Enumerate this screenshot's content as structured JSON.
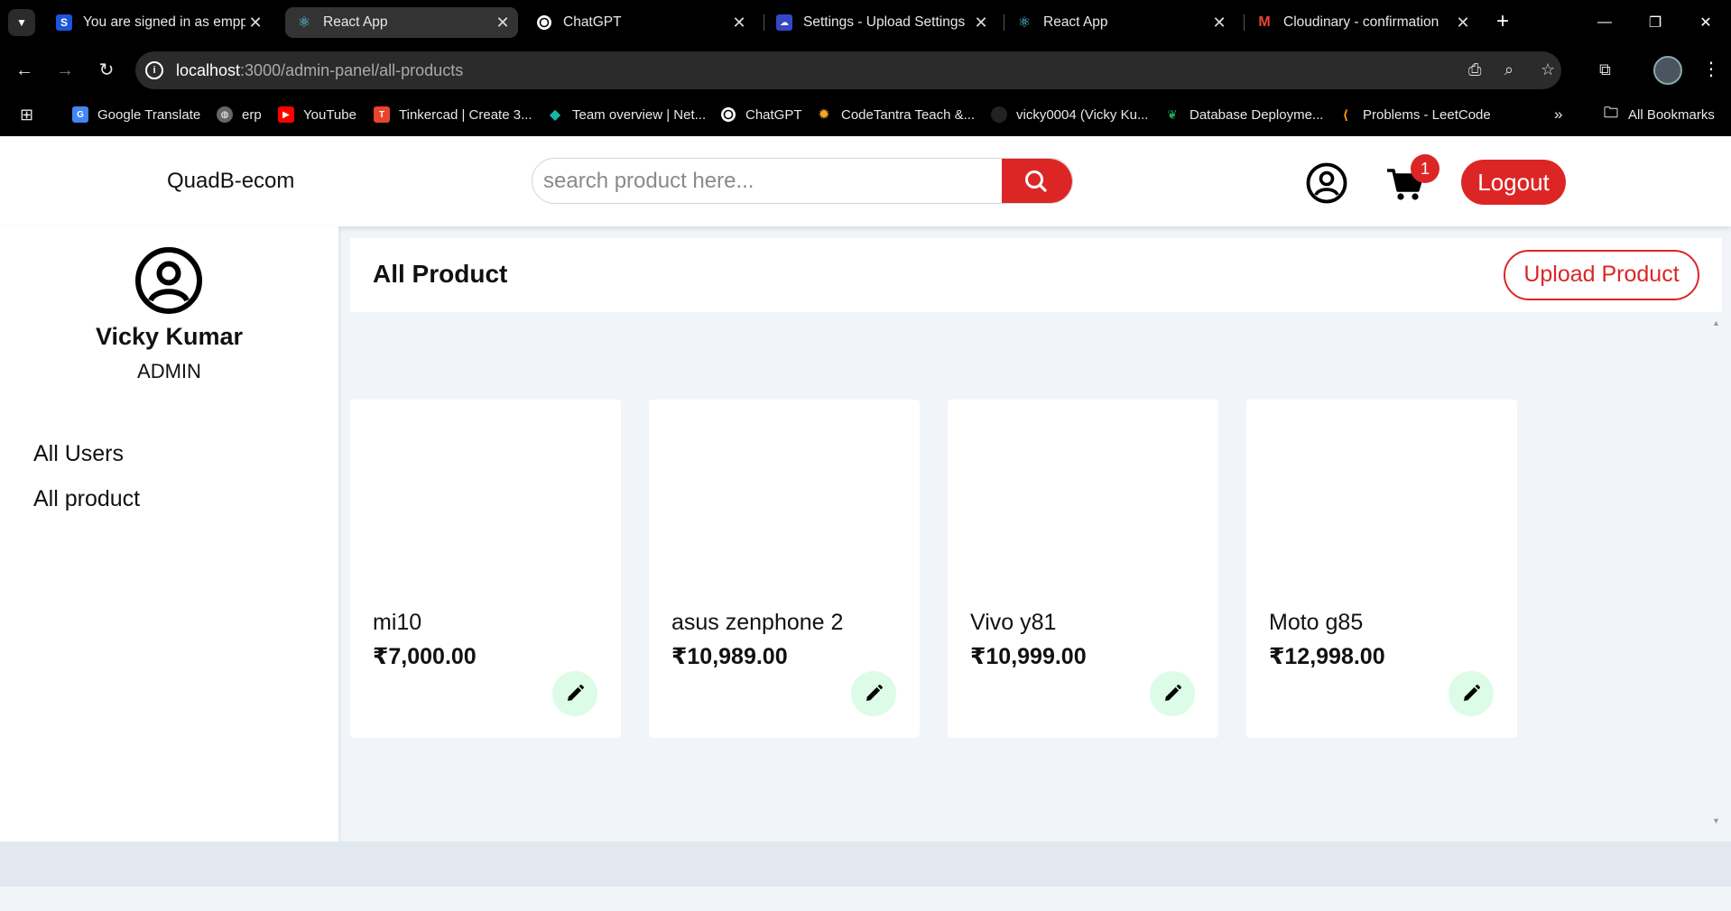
{
  "browser": {
    "tabs": [
      {
        "title": "You are signed in as empp",
        "favicon": "S"
      },
      {
        "title": "React App",
        "favicon": "react-icon",
        "active": true
      },
      {
        "title": "ChatGPT",
        "favicon": "chatgpt-icon"
      },
      {
        "title": "Settings - Upload Settings",
        "favicon": "cloud-icon"
      },
      {
        "title": "React App",
        "favicon": "react-icon"
      },
      {
        "title": "Cloudinary - confirmation",
        "favicon": "M"
      }
    ],
    "url_host": "localhost",
    "url_path": ":3000/admin-panel/all-products",
    "bookmarks": [
      {
        "label": "Google Translate",
        "icon": "G",
        "color": "#4285f4"
      },
      {
        "label": "erp",
        "icon": "globe-icon",
        "color": "#888888"
      },
      {
        "label": "YouTube",
        "icon": "▶",
        "color": "#ff0000"
      },
      {
        "label": "Tinkercad | Create 3...",
        "icon": "T",
        "color": "#e8442b"
      },
      {
        "label": "Team overview | Net...",
        "icon": "◆",
        "color": "#15b8a6"
      },
      {
        "label": "ChatGPT",
        "icon": "chatgpt-icon",
        "color": "#ffffff"
      },
      {
        "label": "CodeTantra Teach &...",
        "icon": "✹",
        "color": "#f5a623"
      },
      {
        "label": "vicky0004 (Vicky Ku...",
        "icon": "github-icon",
        "color": "#222222"
      },
      {
        "label": "Database Deployme...",
        "icon": "leaf-icon",
        "color": "#13aa52"
      },
      {
        "label": "Problems - LeetCode",
        "icon": "leetcode-icon",
        "color": "#ffa116"
      }
    ],
    "all_bookmarks": "All Bookmarks"
  },
  "header": {
    "brand": "QuadB-ecom",
    "search_placeholder": "search product here...",
    "cart_count": "1",
    "logout_label": "Logout"
  },
  "sidebar": {
    "user_name": "Vicky Kumar",
    "user_role": "ADMIN",
    "links": [
      "All Users",
      "All product"
    ]
  },
  "main": {
    "title": "All Product",
    "upload_label": "Upload Product",
    "products": [
      {
        "name": "mi10",
        "price": "₹7,000.00"
      },
      {
        "name": "asus zenphone 2",
        "price": "₹10,989.00"
      },
      {
        "name": "Vivo y81",
        "price": "₹10,999.00"
      },
      {
        "name": "Moto g85",
        "price": "₹12,998.00"
      }
    ]
  },
  "colors": {
    "accent": "#dc2626",
    "edit_bg": "#dcfce7"
  }
}
